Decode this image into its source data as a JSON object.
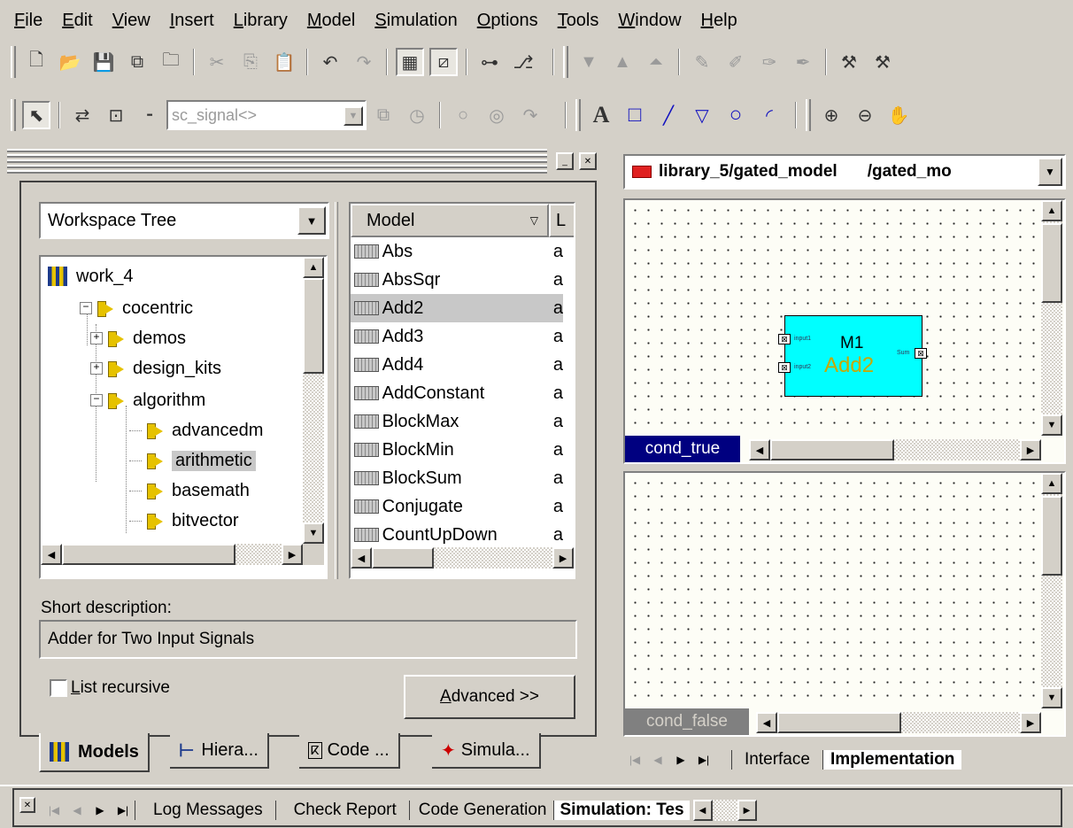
{
  "menu": [
    "File",
    "Edit",
    "View",
    "Insert",
    "Library",
    "Model",
    "Simulation",
    "Options",
    "Tools",
    "Window",
    "Help"
  ],
  "menu_underline": [
    "F",
    "E",
    "V",
    "I",
    "L",
    "M",
    "S",
    "O",
    "T",
    "W",
    "H"
  ],
  "toolbar2": {
    "signal_combo": "sc_signal<>"
  },
  "left_panel": {
    "workspace_combo": "Workspace Tree",
    "tree": [
      {
        "label": "work_4",
        "icon": "books-icon",
        "level": 0
      },
      {
        "label": "cocentric",
        "icon": "folder-icon",
        "level": 1,
        "expander": "−"
      },
      {
        "label": "demos",
        "icon": "folder-icon",
        "level": 2,
        "expander": "+"
      },
      {
        "label": "design_kits",
        "icon": "folder-icon",
        "level": 2,
        "expander": "+"
      },
      {
        "label": "algorithm",
        "icon": "folder-icon",
        "level": 2,
        "expander": "−"
      },
      {
        "label": "advancedm",
        "icon": "folder-icon",
        "level": 3
      },
      {
        "label": "arithmetic",
        "icon": "folder-icon",
        "level": 3,
        "selected": true
      },
      {
        "label": "basemath",
        "icon": "folder-icon",
        "level": 3
      },
      {
        "label": "bitvector",
        "icon": "folder-icon",
        "level": 3
      }
    ],
    "models_header": {
      "col1": "Model",
      "col2": "L"
    },
    "models": [
      {
        "name": "Abs",
        "lib": "a"
      },
      {
        "name": "AbsSqr",
        "lib": "a"
      },
      {
        "name": "Add2",
        "lib": "a",
        "selected": true
      },
      {
        "name": "Add3",
        "lib": "a"
      },
      {
        "name": "Add4",
        "lib": "a"
      },
      {
        "name": "AddConstant",
        "lib": "a"
      },
      {
        "name": "BlockMax",
        "lib": "a"
      },
      {
        "name": "BlockMin",
        "lib": "a"
      },
      {
        "name": "BlockSum",
        "lib": "a"
      },
      {
        "name": "Conjugate",
        "lib": "a"
      },
      {
        "name": "CountUpDown",
        "lib": "a"
      }
    ],
    "short_desc_label": "Short description:",
    "short_desc_value": "Adder for Two Input Signals",
    "list_recursive": "List recursive",
    "list_recursive_u": "L",
    "advanced_button": "Advanced >>",
    "advanced_u": "A",
    "tabs": [
      "Models",
      "Hiera...",
      "Code ...",
      "Simula..."
    ]
  },
  "right_panel": {
    "doc_title": "library_5/gated_model",
    "doc_title2": "/gated_mo",
    "block": {
      "instance": "M1",
      "type": "Add2",
      "in1": "input1",
      "in2": "input2",
      "out": "Sum"
    },
    "cond_true": "cond_true",
    "cond_false": "cond_false",
    "tabs": [
      "Interface",
      "Implementation"
    ]
  },
  "bottom_tabs": [
    "Log Messages",
    "Check Report",
    "Code Generation",
    "Simulation: Tes"
  ],
  "colors": {
    "accent_blue": "#000080",
    "block_fill": "#00ffff",
    "block_type_text": "#c8a800",
    "selection": "#c8c8c8",
    "canvas_bg": "#fdfdf6"
  }
}
